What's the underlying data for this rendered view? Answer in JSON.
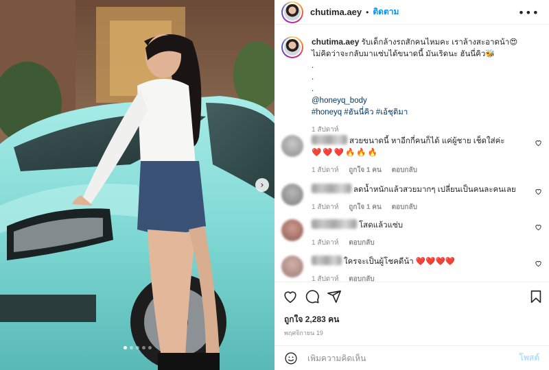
{
  "header": {
    "username": "chutima.aey",
    "separator": "•",
    "follow_label": "ติดตาม",
    "more_icon": "more-horizontal-icon"
  },
  "caption": {
    "username": "chutima.aey",
    "line1": "รับเด็กล้างรถสักคนไหมคะ เราล้างสะอาดน้า😍",
    "line2": "ไม่คิดว่าจะกลับมาแซ่บได้ขนาดนี้ มันเริดนะ ฮันนี่คิว🐝",
    "dot1": ".",
    "dot2": ".",
    "dot3": ".",
    "mention": "@honeyq_body",
    "hashtags": "#honeyq #ฮันนี่คิว #เอ้ชุติมา",
    "time": "1 สัปดาห์"
  },
  "comments": [
    {
      "text": "สวยขนาดนี้ หาอีกกี่คนก็ได้ แค่ผู้ชาย เช็ดใส่ค่ะ",
      "emoji": "❤️❤️❤️🔥🔥🔥",
      "time": "1 สัปดาห์",
      "likes": "ถูกใจ 1 คน",
      "reply": "ตอบกลับ"
    },
    {
      "text": "ลดน้ำหนักแล้วสวยมากๆ เปลี่ยนเป็นคนละคนเลย",
      "time": "1 สัปดาห์",
      "likes": "ถูกใจ 1 คน",
      "reply": "ตอบกลับ"
    },
    {
      "text": "โสดแล้วแซ่บ",
      "time": "1 สัปดาห์",
      "reply": "ตอบกลับ"
    },
    {
      "text": "ใครจะเป็นผู้โชคดีน้า ❤️❤️❤️❤️",
      "time": "1 สัปดาห์",
      "reply": "ตอบกลับ"
    }
  ],
  "likes_text": "ถูกใจ 2,283 คน",
  "date_text": "พฤศจิกายน 19",
  "comment_box": {
    "placeholder": "เพิ่มความคิดเห็น",
    "post_label": "โพสต์"
  },
  "photo": {
    "slide_count": 5,
    "active_slide": 1,
    "next_icon": "chevron-right-icon"
  },
  "colors": {
    "accent": "#0095f6",
    "hashtag": "#00376b",
    "muted": "#8e8e8e",
    "heart_red": "#ed4956",
    "car_teal": "#7fd8d4"
  }
}
